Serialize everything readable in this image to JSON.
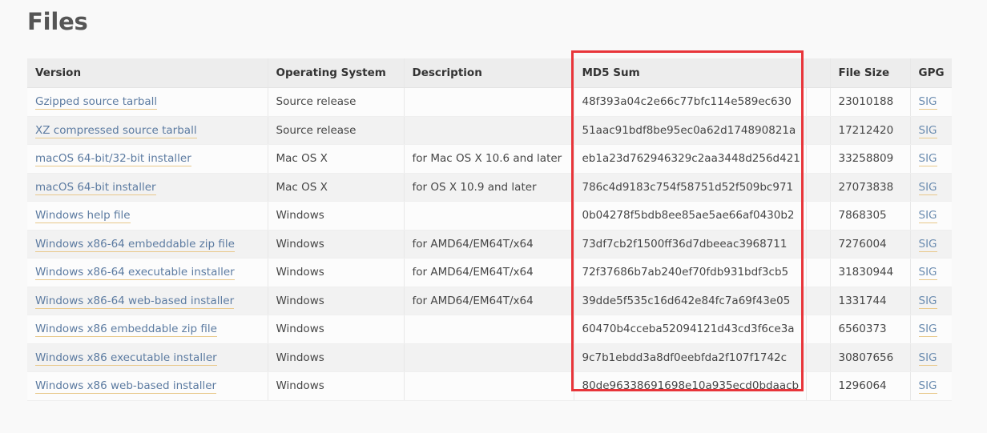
{
  "page": {
    "title": "Files",
    "background_color": "#f9f9f9"
  },
  "annotation": {
    "highlight_color": "#e8353a",
    "highlight_target": "md5-sum-column"
  },
  "table": {
    "columns": [
      {
        "key": "version",
        "label": "Version"
      },
      {
        "key": "os",
        "label": "Operating System"
      },
      {
        "key": "description",
        "label": "Description"
      },
      {
        "key": "md5",
        "label": "MD5 Sum"
      },
      {
        "key": "gap",
        "label": ""
      },
      {
        "key": "size",
        "label": "File Size"
      },
      {
        "key": "gpg",
        "label": "GPG"
      }
    ],
    "rows": [
      {
        "version": "Gzipped source tarball",
        "os": "Source release",
        "description": "",
        "md5": "48f393a04c2e66c77bfc114e589ec630",
        "size": "23010188",
        "gpg": "SIG"
      },
      {
        "version": "XZ compressed source tarball",
        "os": "Source release",
        "description": "",
        "md5": "51aac91bdf8be95ec0a62d174890821a",
        "size": "17212420",
        "gpg": "SIG"
      },
      {
        "version": "macOS 64-bit/32-bit installer",
        "os": "Mac OS X",
        "description": "for Mac OS X 10.6 and later",
        "md5": "eb1a23d762946329c2aa3448d256d421",
        "size": "33258809",
        "gpg": "SIG"
      },
      {
        "version": "macOS 64-bit installer",
        "os": "Mac OS X",
        "description": "for OS X 10.9 and later",
        "md5": "786c4d9183c754f58751d52f509bc971",
        "size": "27073838",
        "gpg": "SIG"
      },
      {
        "version": "Windows help file",
        "os": "Windows",
        "description": "",
        "md5": "0b04278f5bdb8ee85ae5ae66af0430b2",
        "size": "7868305",
        "gpg": "SIG"
      },
      {
        "version": "Windows x86-64 embeddable zip file",
        "os": "Windows",
        "description": "for AMD64/EM64T/x64",
        "md5": "73df7cb2f1500ff36d7dbeeac3968711",
        "size": "7276004",
        "gpg": "SIG"
      },
      {
        "version": "Windows x86-64 executable installer",
        "os": "Windows",
        "description": "for AMD64/EM64T/x64",
        "md5": "72f37686b7ab240ef70fdb931bdf3cb5",
        "size": "31830944",
        "gpg": "SIG"
      },
      {
        "version": "Windows x86-64 web-based installer",
        "os": "Windows",
        "description": "for AMD64/EM64T/x64",
        "md5": "39dde5f535c16d642e84fc7a69f43e05",
        "size": "1331744",
        "gpg": "SIG"
      },
      {
        "version": "Windows x86 embeddable zip file",
        "os": "Windows",
        "description": "",
        "md5": "60470b4cceba52094121d43cd3f6ce3a",
        "size": "6560373",
        "gpg": "SIG"
      },
      {
        "version": "Windows x86 executable installer",
        "os": "Windows",
        "description": "",
        "md5": "9c7b1ebdd3a8df0eebfda2f107f1742c",
        "size": "30807656",
        "gpg": "SIG"
      },
      {
        "version": "Windows x86 web-based installer",
        "os": "Windows",
        "description": "",
        "md5": "80de96338691698e10a935ecd0bdaacb",
        "size": "1296064",
        "gpg": "SIG"
      }
    ]
  }
}
